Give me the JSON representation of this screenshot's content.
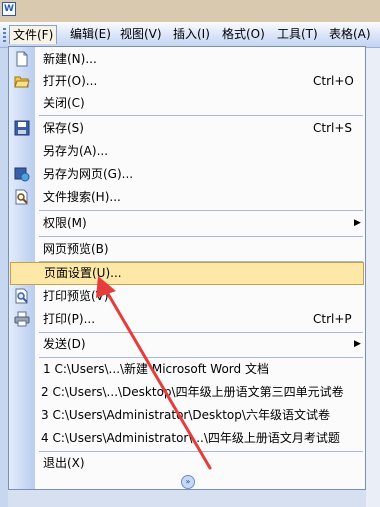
{
  "menubar": {
    "items": [
      {
        "label": "文件(F)",
        "key": "file"
      },
      {
        "label": "编辑(E)",
        "key": "edit"
      },
      {
        "label": "视图(V)",
        "key": "view"
      },
      {
        "label": "插入(I)",
        "key": "insert"
      },
      {
        "label": "格式(O)",
        "key": "format"
      },
      {
        "label": "工具(T)",
        "key": "tools"
      },
      {
        "label": "表格(A)",
        "key": "table"
      }
    ]
  },
  "file_menu": {
    "items": {
      "new": {
        "label": "新建(N)..."
      },
      "open": {
        "label": "打开(O)...",
        "shortcut": "Ctrl+O"
      },
      "close": {
        "label": "关闭(C)"
      },
      "save": {
        "label": "保存(S)",
        "shortcut": "Ctrl+S"
      },
      "save_as": {
        "label": "另存为(A)..."
      },
      "save_as_web": {
        "label": "另存为网页(G)..."
      },
      "file_search": {
        "label": "文件搜索(H)..."
      },
      "permission": {
        "label": "权限(M)"
      },
      "web_preview": {
        "label": "网页预览(B)"
      },
      "page_setup": {
        "label": "页面设置(U)..."
      },
      "print_preview": {
        "label": "打印预览(V)"
      },
      "print": {
        "label": "打印(P)...",
        "shortcut": "Ctrl+P"
      },
      "send_to": {
        "label": "发送(D)"
      },
      "recent_1": {
        "label": "1 C:\\Users\\...\\新建 Microsoft Word 文档"
      },
      "recent_2": {
        "label": "2 C:\\Users\\...\\Desktop\\四年级上册语文第三四单元试卷"
      },
      "recent_3": {
        "label": "3 C:\\Users\\Administrator\\Desktop\\六年级语文试卷"
      },
      "recent_4": {
        "label": "4 C:\\Users\\Administrator\\...\\四年级上册语文月考试题"
      },
      "exit": {
        "label": "退出(X)"
      }
    }
  },
  "icons": [
    "word-app-icon",
    "new-document-icon",
    "open-folder-icon",
    "save-disk-icon",
    "save-as-web-icon",
    "file-search-icon",
    "print-preview-icon",
    "printer-icon",
    "expand-chevron-icon"
  ],
  "colors": {
    "highlight": "#fde8a8",
    "annotation_arrow": "#e53c3c"
  }
}
